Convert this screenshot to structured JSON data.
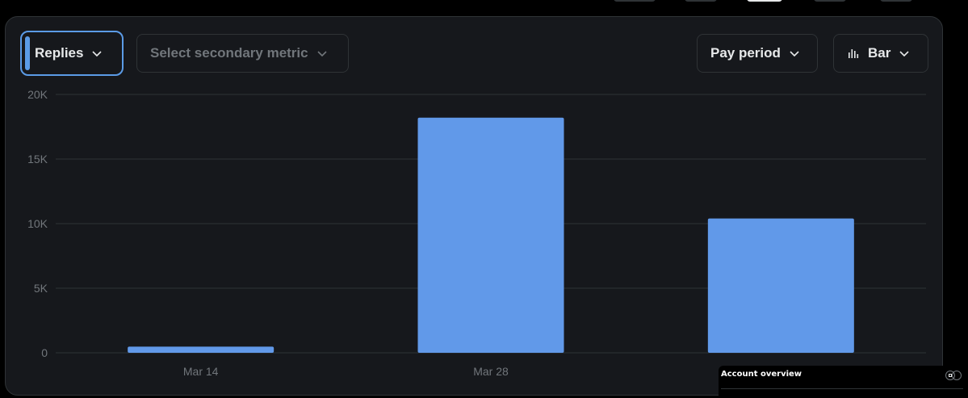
{
  "controls": {
    "primary_metric": "Replies",
    "secondary_metric_placeholder": "Select secondary metric",
    "period": "Pay period",
    "chart_type": "Bar"
  },
  "colors": {
    "accent": "#5b9be6",
    "bar": "#6199e9",
    "background": "#16181c",
    "grid": "#2f3336",
    "text_muted": "#71767b",
    "text": "#e7e9ea"
  },
  "overview": {
    "label": "Account overview"
  },
  "chart_data": {
    "type": "bar",
    "categories": [
      "Mar 14",
      "Mar 28",
      ""
    ],
    "series": [
      {
        "values": [
          480,
          18200,
          10400
        ]
      }
    ],
    "y_ticks": [
      0,
      5000,
      10000,
      15000,
      20000
    ],
    "y_tick_labels": [
      "0",
      "5K",
      "10K",
      "15K",
      "20K"
    ],
    "ylim": [
      0,
      20000
    ],
    "grid": true,
    "title": "",
    "xlabel": "",
    "ylabel": ""
  }
}
